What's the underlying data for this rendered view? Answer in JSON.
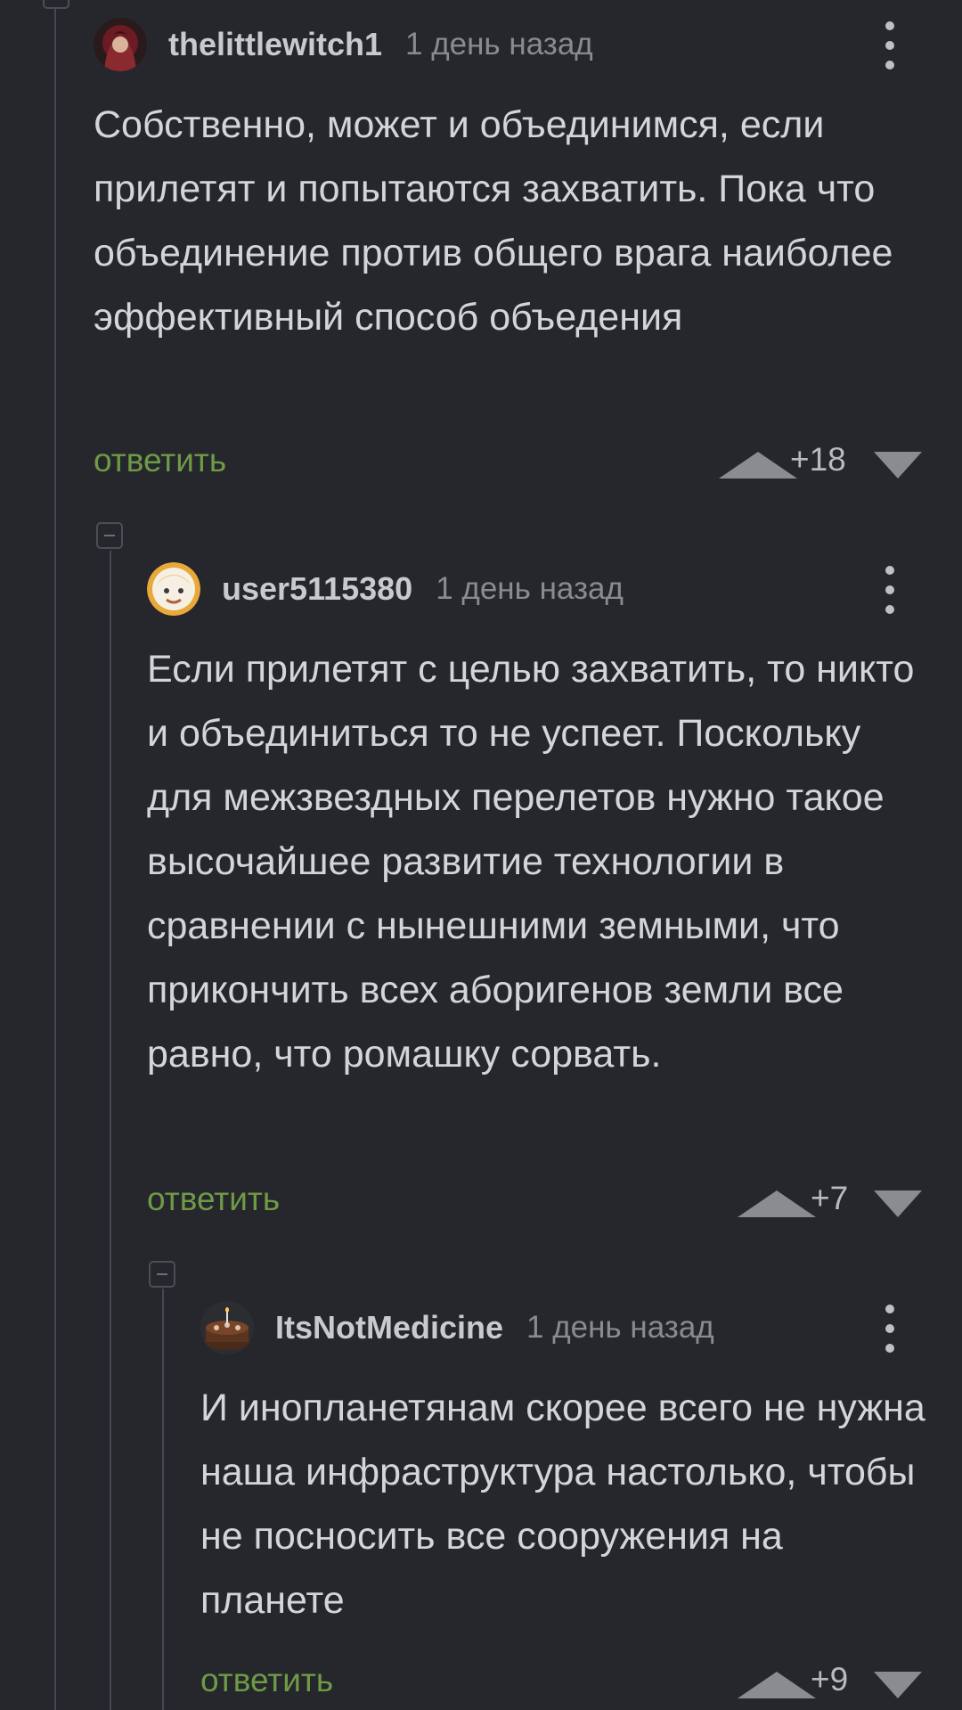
{
  "comments": [
    {
      "username": "thelittlewitch1",
      "time": "1 день назад",
      "text": "Собственно, может и объединимся, если прилетят и попытаются захватить. Пока что объединение против общего врага наиболее эффективный способ объедения",
      "reply_label": "ответить",
      "rating": "+18",
      "avatar_icon": "dark-hooded-figure-avatar"
    },
    {
      "username": "user5115380",
      "time": "1 день назад",
      "text": "Если прилетят с целью захватить, то никто и объединиться то не успеет. Поскольку для межзвездных перелетов нужно такое высочайшее развитие технологии в сравнении с нынешними земными, что прикончить всех аборигенов земли все равно, что ромашку сорвать.",
      "reply_label": "ответить",
      "rating": "+7",
      "avatar_icon": "cartoon-face-avatar"
    },
    {
      "username": "ItsNotMedicine",
      "time": "1 день назад",
      "text": "И инопланетянам скорее всего не нужна наша инфраструктура настолько, чтобы не посносить все сооружения на планете",
      "reply_label": "ответить",
      "rating": "+9",
      "avatar_icon": "cake-avatar"
    }
  ],
  "colors": {
    "background": "#25272c",
    "reply_link": "#6f9a46",
    "thread_line": "#45484e",
    "vote_arrow": "#8a8c91"
  }
}
